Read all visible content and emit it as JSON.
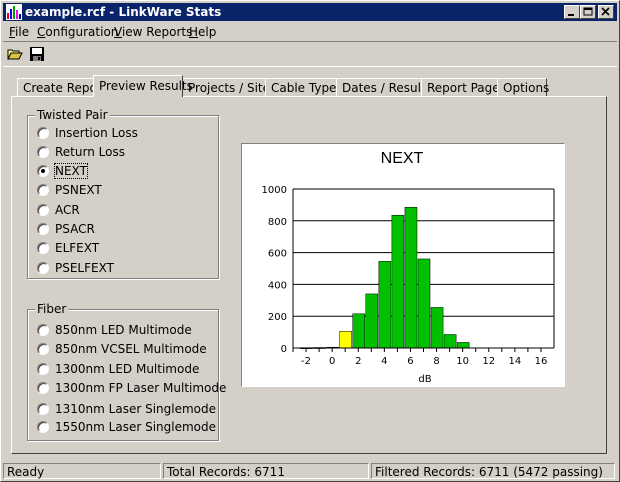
{
  "window": {
    "title": "example.rcf - LinkWare Stats"
  },
  "menu": [
    {
      "label": "File",
      "mnemonic": "F",
      "rest": "ile"
    },
    {
      "label": "Configuration",
      "mnemonic": "C",
      "rest": "onfiguration"
    },
    {
      "label": "View Reports",
      "mnemonic": "V",
      "rest": "iew Reports"
    },
    {
      "label": "Help",
      "mnemonic": "H",
      "rest": "elp"
    }
  ],
  "toolbar": {
    "icons": [
      "open-folder-icon",
      "save-disk-icon"
    ]
  },
  "tabs": [
    {
      "label": "Create Report",
      "active": false
    },
    {
      "label": "Preview Results",
      "active": true
    },
    {
      "label": "Projects / Sites",
      "active": false
    },
    {
      "label": "Cable Types",
      "active": false
    },
    {
      "label": "Dates / Results",
      "active": false
    },
    {
      "label": "Report Pages",
      "active": false
    },
    {
      "label": "Options",
      "active": false
    }
  ],
  "twisted_pair": {
    "label": "Twisted Pair",
    "options": [
      "Insertion Loss",
      "Return Loss",
      "NEXT",
      "PSNEXT",
      "ACR",
      "PSACR",
      "ELFEXT",
      "PSELFEXT"
    ],
    "selected": "NEXT"
  },
  "fiber": {
    "label": "Fiber",
    "options": [
      "850nm LED Multimode",
      "850nm VCSEL Multimode",
      "1300nm LED Multimode",
      "1300nm FP Laser Multimode",
      "1310nm Laser Singlemode",
      "1550nm Laser Singlemode"
    ]
  },
  "chart_data": {
    "type": "bar",
    "title": "NEXT",
    "xlabel": "dB",
    "ylabel": "",
    "xlim": [
      -3,
      17
    ],
    "ylim": [
      0,
      1000
    ],
    "xticks": [
      -2,
      0,
      2,
      4,
      6,
      8,
      10,
      12,
      14,
      16
    ],
    "yticks": [
      0,
      200,
      400,
      600,
      800,
      1000
    ],
    "grid": true,
    "bin_width": 1,
    "bins": [
      -2,
      -1,
      0,
      1,
      2,
      3,
      4,
      5,
      6,
      7,
      8,
      9,
      10
    ],
    "values": [
      2,
      3,
      5,
      105,
      215,
      340,
      545,
      835,
      885,
      560,
      255,
      85,
      35
    ],
    "colors": [
      "#ff0000",
      "#ff0000",
      "#ff0000",
      "#ffff00",
      "#00c000",
      "#00c000",
      "#00c000",
      "#00c000",
      "#00c000",
      "#00c000",
      "#00c000",
      "#00c000",
      "#00c000"
    ]
  },
  "status": {
    "ready": "Ready",
    "total": "Total Records: 6711",
    "filtered": "Filtered Records: 6711 (5472 passing)"
  }
}
